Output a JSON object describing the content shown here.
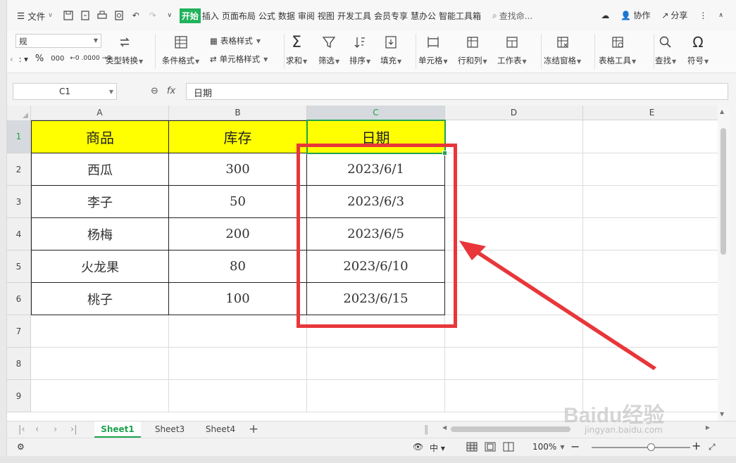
{
  "menubar": {
    "file_label": "文件",
    "tabs": [
      "开始",
      "插入",
      "页面布局",
      "公式",
      "数据",
      "审阅",
      "视图",
      "开发工具",
      "会员专享",
      "慧办公",
      "智能工具箱"
    ],
    "active_tab": "开始",
    "search_placeholder": "查找命...",
    "collab_label": "协作",
    "share_label": "分享"
  },
  "ribbon": {
    "number_format": "规",
    "percent": "%",
    "thousands": "000",
    "inc_decimal": "←0 .00",
    "dec_decimal": ".00 →0",
    "type_convert": "类型转换",
    "conditional_format": "条件格式",
    "table_style": "表格样式",
    "cell_style": "单元格样式",
    "sum": "求和",
    "filter": "筛选",
    "sort": "排序",
    "fill": "填充",
    "cell": "单元格",
    "row_col": "行和列",
    "worksheet": "工作表",
    "freeze": "冻结窗格",
    "table_tools": "表格工具",
    "find": "查找",
    "symbol": "符号"
  },
  "formula": {
    "name_box": "C1",
    "fx": "fx",
    "content": "日期"
  },
  "grid": {
    "columns": [
      "A",
      "B",
      "C",
      "D",
      "E"
    ],
    "rows": [
      "1",
      "2",
      "3",
      "4",
      "5",
      "6",
      "7",
      "8",
      "9"
    ],
    "headers": [
      "商品",
      "库存",
      "日期"
    ],
    "data": [
      [
        "西瓜",
        "300",
        "2023/6/1"
      ],
      [
        "李子",
        "50",
        "2023/6/3"
      ],
      [
        "杨梅",
        "200",
        "2023/6/5"
      ],
      [
        "火龙果",
        "80",
        "2023/6/10"
      ],
      [
        "桃子",
        "100",
        "2023/6/15"
      ]
    ]
  },
  "sheets": [
    "Sheet1",
    "Sheet3",
    "Sheet4"
  ],
  "active_sheet": "Sheet1",
  "status": {
    "zoom": "100%",
    "zoom_fraction": 0.6
  },
  "watermark": {
    "brand": "Baidu经验",
    "url": "jingyan.baidu.com"
  },
  "colors": {
    "accent": "#1fa24e",
    "header_fill": "#ffff00",
    "annotation": "#e8363a"
  }
}
